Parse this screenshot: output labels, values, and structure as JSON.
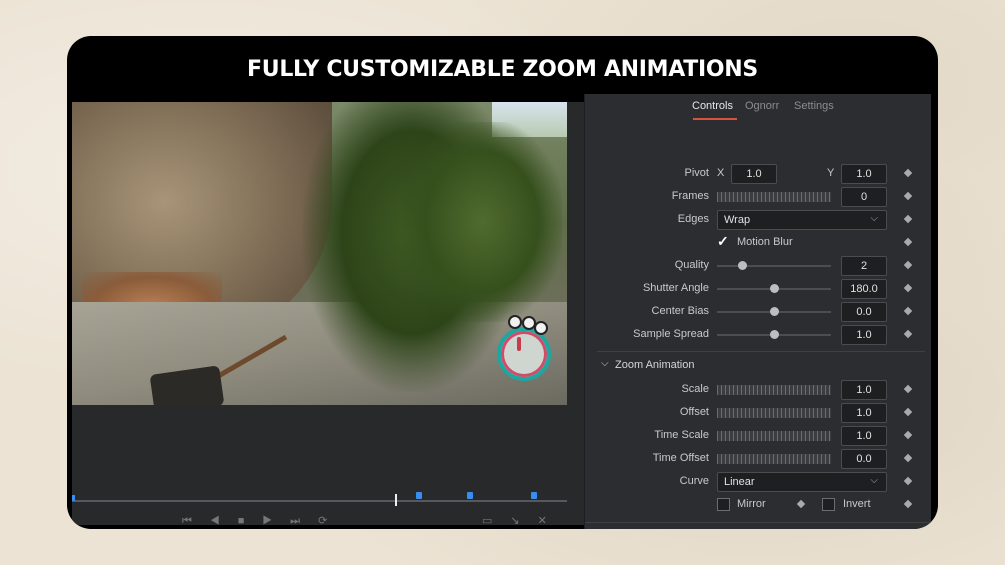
{
  "headline": "FULLY CUSTOMIZABLE ZOOM ANIMATIONS",
  "tabs": [
    "Controls",
    "Ognorr",
    "Settings"
  ],
  "pivot": {
    "label": "Pivot",
    "x_label": "X",
    "x": "1.0",
    "y_label": "Y",
    "y": "1.0"
  },
  "rows": {
    "frames": {
      "label": "Frames",
      "value": "0"
    },
    "edges": {
      "label": "Edges",
      "value": "Wrap"
    },
    "motion_blur": {
      "label": "Motion Blur",
      "checked": true
    },
    "quality": {
      "label": "Quality",
      "value": "2",
      "level": 0.22
    },
    "shutter_angle": {
      "label": "Shutter Angle",
      "value": "180.0",
      "level": 0.5
    },
    "center_bias": {
      "label": "Center Bias",
      "value": "0.0",
      "level": 0.5
    },
    "sample_spread": {
      "label": "Sample Spread",
      "value": "1.0",
      "level": 0.5
    }
  },
  "zoom_section": {
    "title": "Zoom Animation",
    "scale": {
      "label": "Scale",
      "value": "1.0"
    },
    "offset": {
      "label": "Offset",
      "value": "1.0"
    },
    "time_scale": {
      "label": "Time Scale",
      "value": "1.0"
    },
    "time_offset": {
      "label": "Time Offset",
      "value": "0.0"
    },
    "curve": {
      "label": "Curve",
      "value": "Linear"
    },
    "mirror": {
      "label": "Mirror",
      "checked": false
    },
    "invert": {
      "label": "Invert",
      "checked": false
    }
  },
  "colors": {
    "accent": "#d4553b",
    "keyframe": "#3a8df0",
    "panel": "#2c2d30"
  },
  "icons": {
    "keyframe": "diamond-icon",
    "dropdown": "chevron-down-icon",
    "section": "chevron-down-icon",
    "check": "checkmark-icon"
  }
}
